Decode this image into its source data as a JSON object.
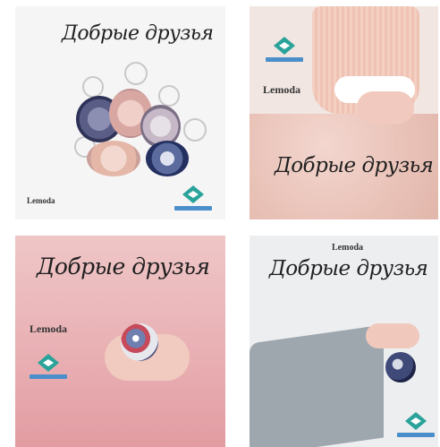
{
  "tiles": [
    {
      "title_script": "Добрые друзья",
      "brand": "Lemoda"
    },
    {
      "title_script": "Добрые друзья",
      "brand": "Lemoda"
    },
    {
      "title_script": "Добрые друзья",
      "brand": "Lemoda"
    },
    {
      "title_script": "Добрые друзья",
      "brand": "Lemoda"
    }
  ],
  "colors": {
    "logo_teal": "#2aa39a",
    "logo_blue": "#4a8fc9"
  }
}
